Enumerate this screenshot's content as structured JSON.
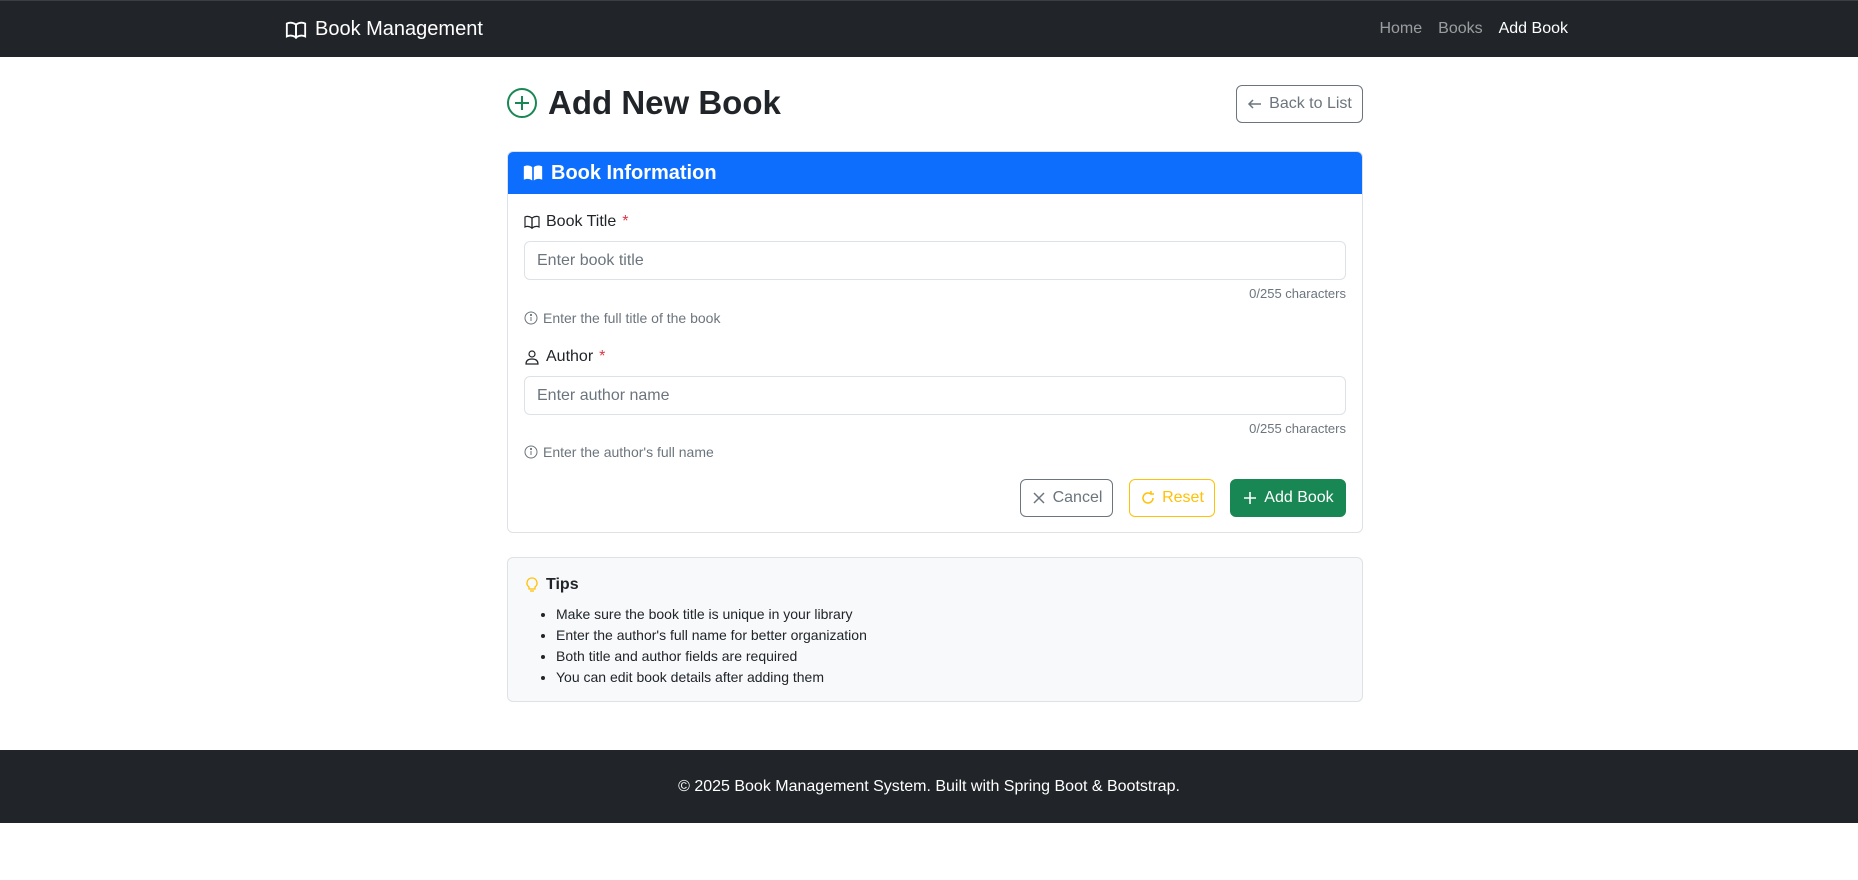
{
  "navbar": {
    "brand": "Book Management",
    "links": [
      {
        "label": "Home"
      },
      {
        "label": "Books"
      },
      {
        "label": "Add Book"
      }
    ]
  },
  "header": {
    "title": "Add New Book",
    "back_label": "Back to List"
  },
  "card": {
    "title": "Book Information",
    "fields": {
      "title": {
        "label": "Book Title",
        "required": "*",
        "placeholder": "Enter book title",
        "value": "",
        "counter": "0/255 characters",
        "help": "Enter the full title of the book"
      },
      "author": {
        "label": "Author",
        "required": "*",
        "placeholder": "Enter author name",
        "value": "",
        "counter": "0/255 characters",
        "help": "Enter the author's full name"
      }
    },
    "buttons": {
      "cancel": "Cancel",
      "reset": "Reset",
      "add": "Add Book"
    }
  },
  "tips": {
    "title": "Tips",
    "items": [
      "Make sure the book title is unique in your library",
      "Enter the author's full name for better organization",
      "Both title and author fields are required",
      "You can edit book details after adding them"
    ]
  },
  "footer": {
    "text": "© 2025 Book Management System. Built with Spring Boot & Bootstrap."
  },
  "colors": {
    "navbar": "#212529",
    "primary": "#0d6efd",
    "success": "#198754",
    "warning": "#ffc107",
    "secondary": "#6c757d",
    "danger": "#dc3545"
  }
}
